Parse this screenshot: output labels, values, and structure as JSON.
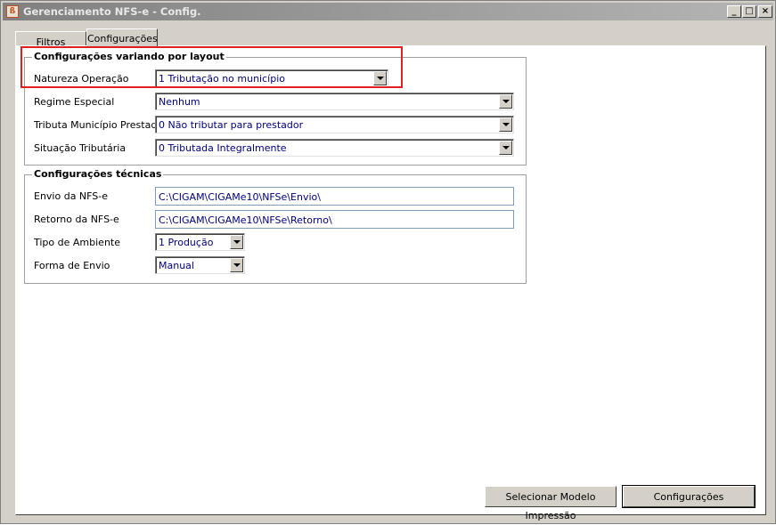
{
  "window": {
    "title": "Gerenciamento NFS-e - Config.",
    "app_icon_glyph": "ß",
    "minimize_glyph": "_",
    "maximize_glyph": "□",
    "close_glyph": "×"
  },
  "tabs": [
    {
      "label": "Filtros",
      "active": false
    },
    {
      "label": "Configurações",
      "active": true
    }
  ],
  "layout_group": {
    "title": "Configurações variando por layout",
    "fields": [
      {
        "label": "Natureza Operação",
        "value": "1 Tributação no município"
      },
      {
        "label": "Regime Especial",
        "value": "Nenhum"
      },
      {
        "label": "Tributa Município Prestador",
        "value": "0 Não tributar para prestador"
      },
      {
        "label": "Situação Tributária",
        "value": "0  Tributada Integralmente"
      }
    ]
  },
  "tech_group": {
    "title": "Configurações técnicas",
    "fields": [
      {
        "label": "Envio da NFS-e",
        "value": "C:\\CIGAM\\CIGAMe10\\NFSe\\Envio\\"
      },
      {
        "label": "Retorno da NFS-e",
        "value": "C:\\CIGAM\\CIGAMe10\\NFSe\\Retorno\\"
      },
      {
        "label": "Tipo de Ambiente",
        "value": "1 Produção"
      },
      {
        "label": "Forma de Envio",
        "value": "Manual"
      }
    ]
  },
  "buttons": {
    "select_model": "Selecionar Modelo Impressão",
    "configurations": "Configurações"
  },
  "colors": {
    "highlight": "#e02020",
    "value_text": "#000080"
  }
}
